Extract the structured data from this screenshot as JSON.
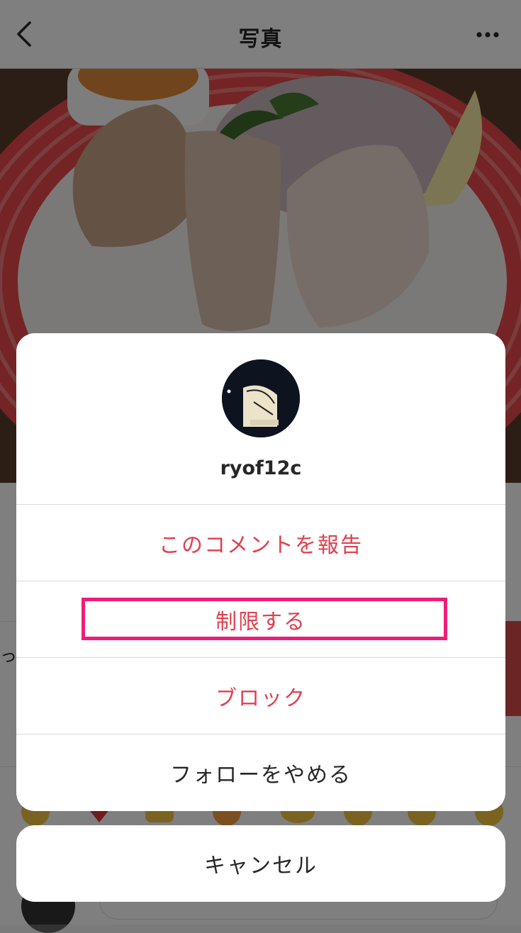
{
  "nav": {
    "title": "写真"
  },
  "underlay": {
    "partial_text": "った"
  },
  "sheet": {
    "username": "ryof12c",
    "options": [
      {
        "label": "このコメントを報告",
        "style": "danger"
      },
      {
        "label": "制限する",
        "style": "danger",
        "highlighted": true
      },
      {
        "label": "ブロック",
        "style": "danger"
      },
      {
        "label": "フォローをやめる",
        "style": "normal"
      }
    ],
    "cancel_label": "キャンセル"
  },
  "colors": {
    "danger": "#e0404e",
    "highlight_border": "#ee1d7a",
    "text": "#262626"
  }
}
